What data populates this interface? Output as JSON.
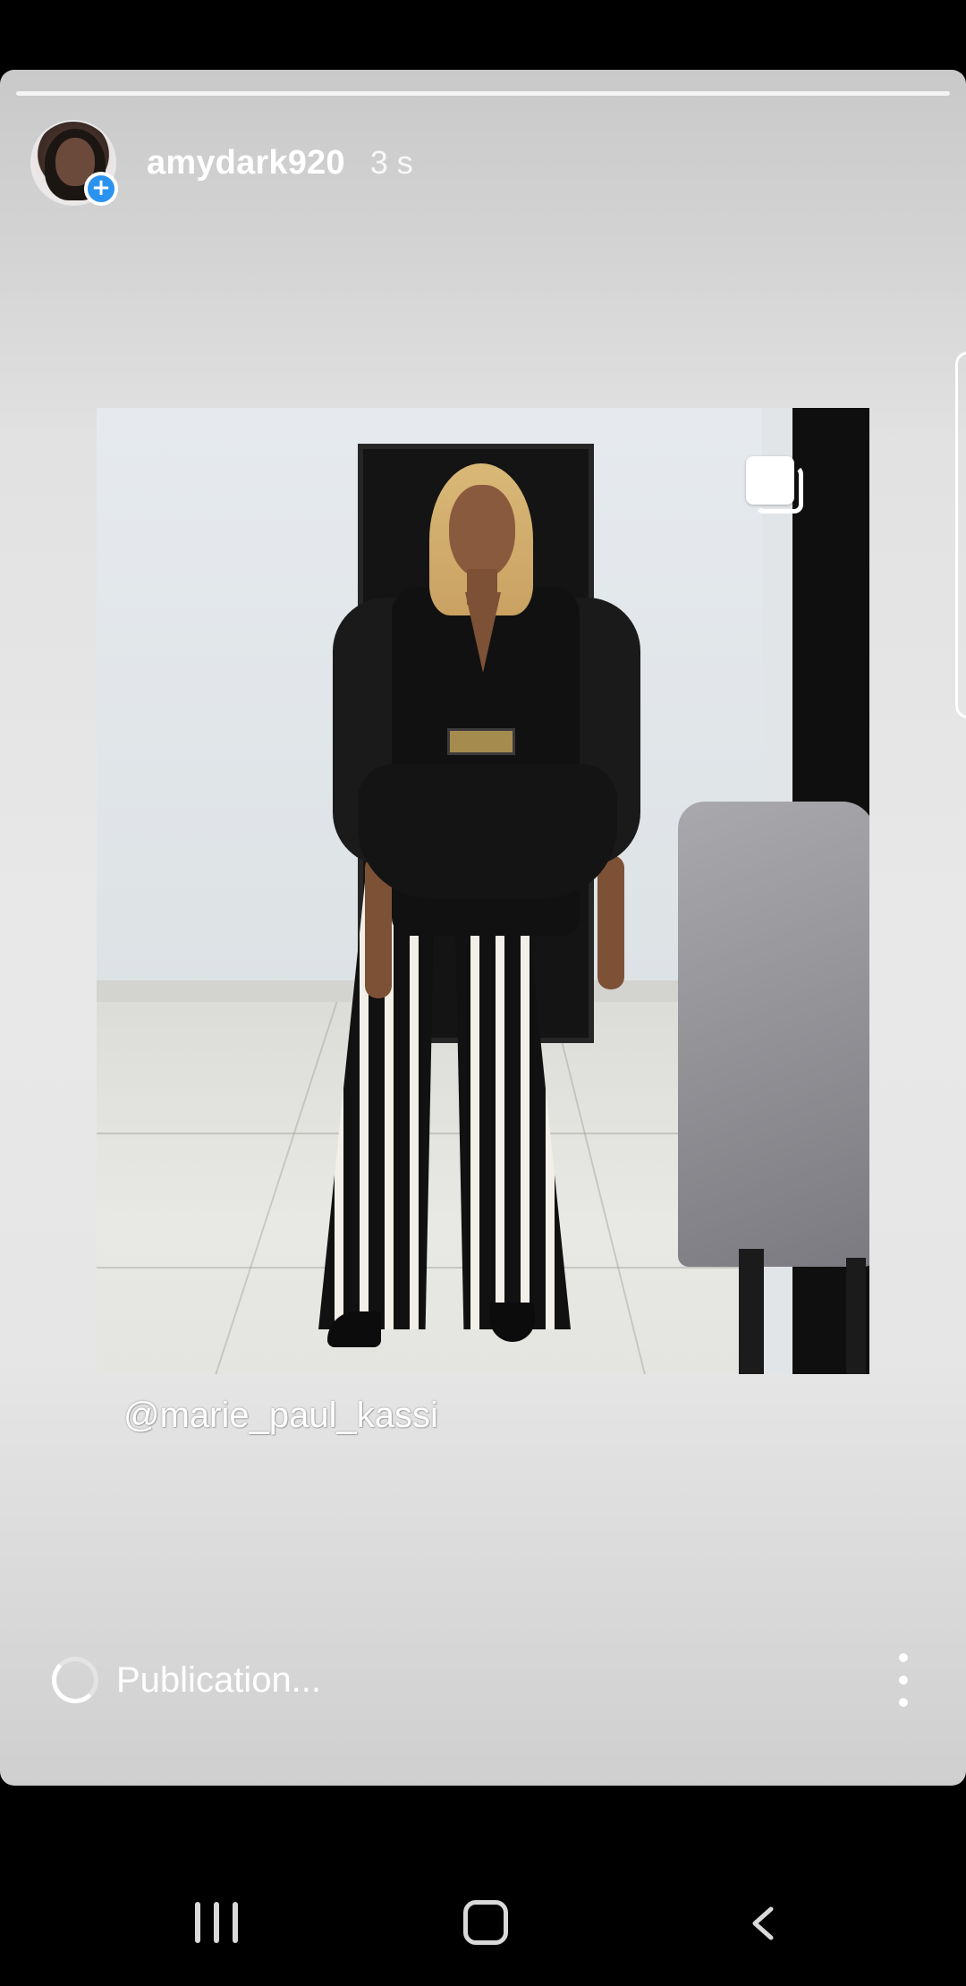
{
  "story": {
    "username": "amydark920",
    "timestamp": "3 s",
    "progress": 1.0,
    "mention": "@marie_paul_kassi",
    "status_text": "Publication..."
  },
  "icons": {
    "avatar": "avatar",
    "add_story": "add-icon",
    "multi_post": "multiple-posts-icon",
    "spinner": "loading-spinner-icon",
    "more": "more-vertical-icon",
    "nav_recent": "recent-apps-icon",
    "nav_home": "home-icon",
    "nav_back": "back-icon"
  },
  "colors": {
    "accent": "#2a93f0",
    "background": "#000000",
    "text": "#ffffff"
  }
}
